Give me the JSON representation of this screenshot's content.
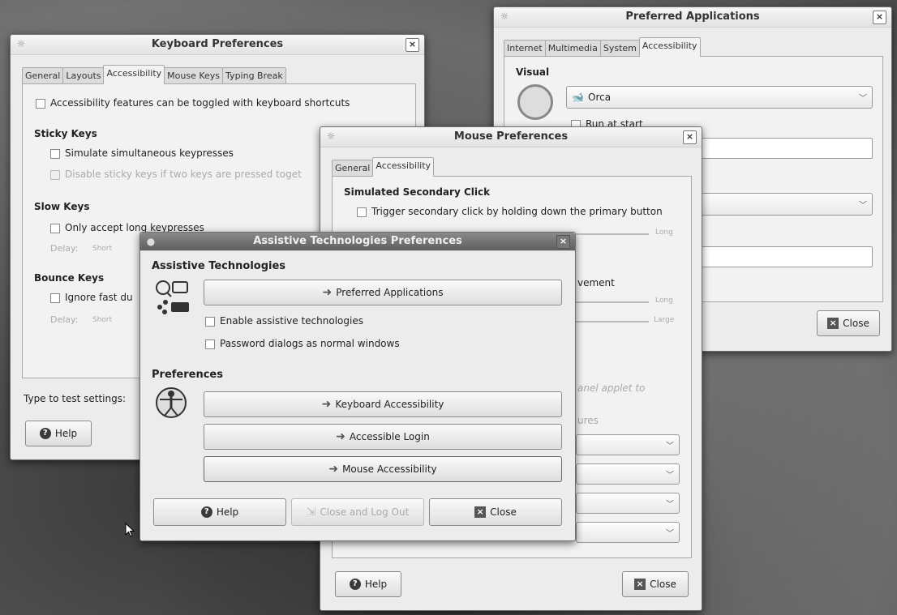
{
  "keyboard": {
    "title": "Keyboard Preferences",
    "tabs": [
      "General",
      "Layouts",
      "Accessibility",
      "Mouse Keys",
      "Typing Break"
    ],
    "toggle_label": "Accessibility features can be toggled with keyboard shortcuts",
    "sticky_heading": "Sticky Keys",
    "sticky_simulate": "Simulate simultaneous keypresses",
    "sticky_disable": "Disable sticky keys if two keys are pressed toget",
    "slow_heading": "Slow Keys",
    "slow_only": "Only accept long keypresses",
    "delay": "Delay:",
    "short": "Short",
    "bounce_heading": "Bounce Keys",
    "bounce_ignore": "Ignore fast du",
    "type_to_test": "Type to test settings:",
    "help": "Help"
  },
  "preferred": {
    "title": "Preferred Applications",
    "tabs": [
      "Internet",
      "Multimedia",
      "System",
      "Accessibility"
    ],
    "visual_heading": "Visual",
    "visual_app": "Orca",
    "run_at_start": "Run at start",
    "close": "Close"
  },
  "mouse": {
    "title": "Mouse Preferences",
    "tabs": [
      "General",
      "Accessibility"
    ],
    "sim_heading": "Simulated Secondary Click",
    "trigger": "Trigger secondary click by holding down the primary button",
    "long": "Long",
    "large": "Large",
    "movement_fragment": "vement",
    "panel_fragment": "anel applet to",
    "features_fragment": "ures",
    "help": "Help",
    "close": "Close"
  },
  "assistive": {
    "title": "Assistive Technologies Preferences",
    "at_heading": "Assistive Technologies",
    "preferred_btn": "Preferred Applications",
    "enable_at": "Enable assistive technologies",
    "password_dialogs": "Password dialogs as normal windows",
    "prefs_heading": "Preferences",
    "keyboard_btn": "Keyboard Accessibility",
    "login_btn": "Accessible Login",
    "mouse_btn": "Mouse Accessibility",
    "help": "Help",
    "logout": "Close and Log Out",
    "close": "Close"
  }
}
